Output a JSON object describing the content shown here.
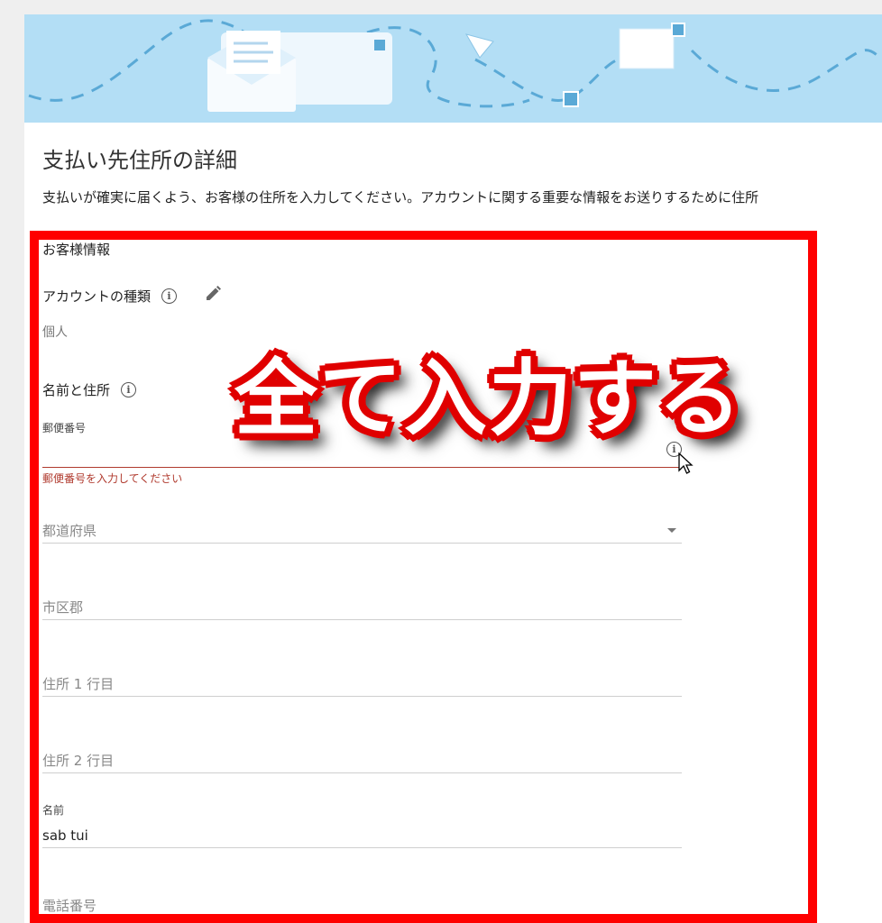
{
  "page": {
    "title": "支払い先住所の詳細",
    "description": "支払いが確実に届くよう、お客様の住所を入力してください。アカウントに関する重要な情報をお送りするために住所"
  },
  "customer_info": {
    "section_label": "お客様情報",
    "account_type_label": "アカウントの種類",
    "account_type_value": "個人",
    "name_address_label": "名前と住所"
  },
  "form": {
    "postal_code": {
      "label": "郵便番号",
      "value": "",
      "error": "郵便番号を入力してください"
    },
    "prefecture": {
      "placeholder": "都道府県"
    },
    "city": {
      "placeholder": "市区郡"
    },
    "address_line1": {
      "placeholder": "住所 1 行目"
    },
    "address_line2": {
      "placeholder": "住所 2 行目"
    },
    "name": {
      "label": "名前",
      "value": "sab tui"
    },
    "phone": {
      "placeholder": "電話番号"
    }
  },
  "annotation": {
    "text": "全て入力する",
    "highlight_color": "#ff0000"
  },
  "icons": {
    "info": "info-icon",
    "edit": "pencil-icon",
    "dropdown": "chevron-down-icon",
    "cursor": "mouse-cursor-icon"
  }
}
